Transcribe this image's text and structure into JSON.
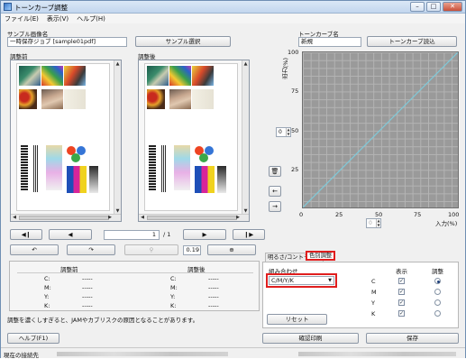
{
  "window": {
    "title": "トーンカーブ調整"
  },
  "menu": [
    "ファイル(E)",
    "表示(V)",
    "ヘルプ(H)"
  ],
  "sample": {
    "label": "サンプル画像名",
    "value": "一時保存ジョブ [sample01pdf]",
    "select_button": "サンプル選択",
    "before_label": "調整前",
    "after_label": "調整後"
  },
  "nav": {
    "page": "1",
    "total": "/ 1",
    "zoom": "0.19"
  },
  "info": {
    "before_title": "調整前",
    "after_title": "調整後",
    "rows": [
      {
        "channel": "C:",
        "before": "-----",
        "after": "-----"
      },
      {
        "channel": "M:",
        "before": "-----",
        "after": "-----"
      },
      {
        "channel": "Y:",
        "before": "-----",
        "after": "-----"
      },
      {
        "channel": "K:",
        "before": "-----",
        "after": "-----"
      }
    ]
  },
  "warning": "調整を濃くしすぎると、JAMやカブリスクの原因となることがあります。",
  "curve": {
    "name_label": "トーンカーブ名",
    "name_value": "新規",
    "load_button": "トーンカーブ読込",
    "ylabel": "出力(%)",
    "xlabel": "入力(%)",
    "y_ticks": [
      "100",
      "75",
      "50",
      "25"
    ],
    "x_ticks": [
      "0",
      "25",
      "50",
      "75",
      "100"
    ],
    "output_value": "0",
    "input_value": "0"
  },
  "tabs": {
    "brightness": "明るさ/コントラスト",
    "color": "色別調整"
  },
  "color_panel": {
    "combo_label": "組み合わせ",
    "combo_value": "C/M/Y/K",
    "show_header": "表示",
    "adjust_header": "調整",
    "channels": [
      "C",
      "M",
      "Y",
      "K"
    ],
    "reset_button": "リセット"
  },
  "buttons": {
    "help": "ヘルプ(F1)",
    "print": "確認印刷",
    "save": "保存"
  },
  "status": {
    "label": "現在の接続先"
  },
  "colors": {
    "highlight": "#e01e1e",
    "graph_bg": "#9a9a9a",
    "curve": "#7fc9d8"
  }
}
